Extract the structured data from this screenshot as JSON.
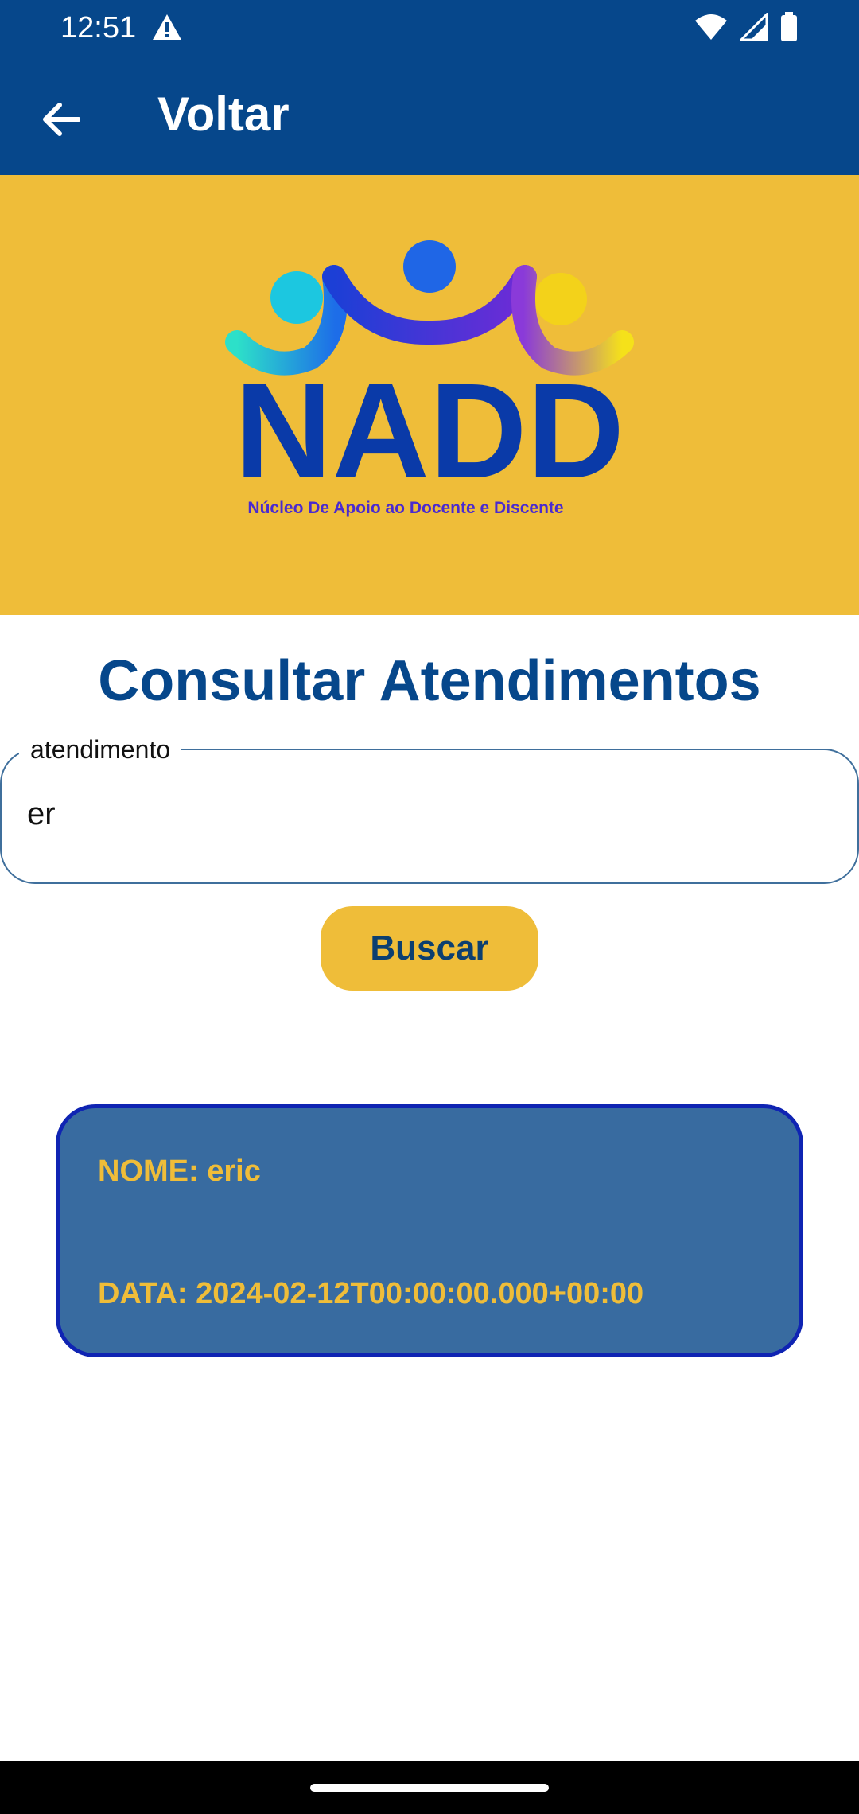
{
  "status_bar": {
    "time": "12:51",
    "icons": [
      "alert-icon",
      "wifi-icon",
      "signal-icon",
      "battery-icon"
    ]
  },
  "app_bar": {
    "back_icon": "arrow-left-icon",
    "title": "Voltar"
  },
  "banner": {
    "logo_text": "NADD",
    "logo_subtitle": "Núcleo De Apoio ao Docente e Discente",
    "background_color": "#efbd39"
  },
  "page": {
    "title": "Consultar Atendimentos"
  },
  "search": {
    "label": "atendimento",
    "value": "er",
    "button_label": "Buscar"
  },
  "results": [
    {
      "name_line": "NOME: eric",
      "date_line": "DATA: 2024-02-12T00:00:00.000+00:00"
    }
  ],
  "colors": {
    "primary": "#06478b",
    "accent": "#efbd39",
    "card": "#386ba0",
    "card_border": "#0f24b3"
  }
}
